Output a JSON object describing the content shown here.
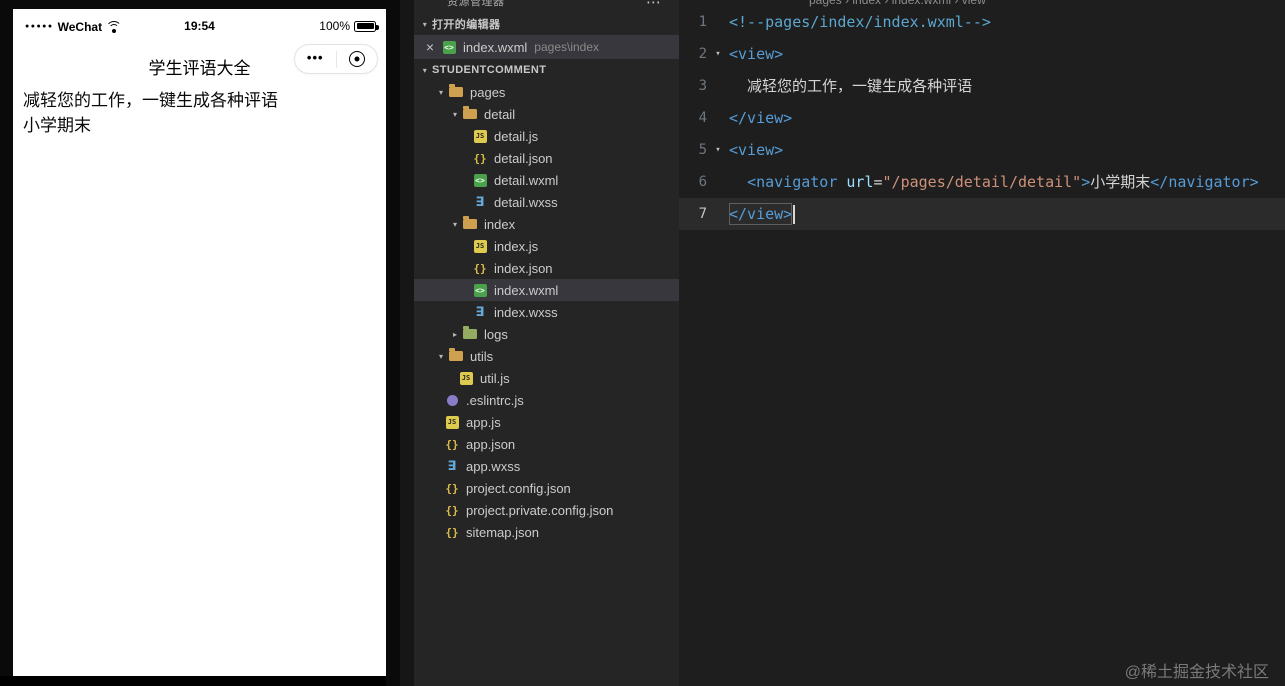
{
  "phone": {
    "status": {
      "signal_dots": "●●●●●",
      "carrier": "WeChat",
      "time": "19:54",
      "battery_pct": "100%"
    },
    "nav_title": "学生评语大全",
    "menu_label": "•••",
    "body_lines": [
      "减轻您的工作，一键生成各种评语",
      "小学期末"
    ]
  },
  "explorer": {
    "panel_title": "资源管理器",
    "open_editors_header": "打开的编辑器",
    "open_editor": {
      "file": "index.wxml",
      "path": "pages\\index",
      "icon": "wxml"
    },
    "project_header": "STUDENTCOMMENT",
    "tree": [
      {
        "label": "pages",
        "type": "folder",
        "depth": 1,
        "expanded": true
      },
      {
        "label": "detail",
        "type": "folder",
        "depth": 2,
        "expanded": true
      },
      {
        "label": "detail.js",
        "type": "js",
        "depth": 3
      },
      {
        "label": "detail.json",
        "type": "json",
        "depth": 3
      },
      {
        "label": "detail.wxml",
        "type": "wxml",
        "depth": 3
      },
      {
        "label": "detail.wxss",
        "type": "wxss",
        "depth": 3
      },
      {
        "label": "index",
        "type": "folder",
        "depth": 2,
        "expanded": true
      },
      {
        "label": "index.js",
        "type": "js",
        "depth": 3
      },
      {
        "label": "index.json",
        "type": "json",
        "depth": 3
      },
      {
        "label": "index.wxml",
        "type": "wxml",
        "depth": 3,
        "selected": true
      },
      {
        "label": "index.wxss",
        "type": "wxss",
        "depth": 3
      },
      {
        "label": "logs",
        "type": "folder",
        "depth": 2,
        "expanded": false,
        "color": "#94ad62"
      },
      {
        "label": "utils",
        "type": "folder",
        "depth": 1,
        "expanded": true
      },
      {
        "label": "util.js",
        "type": "js",
        "depth": 2
      },
      {
        "label": ".eslintrc.js",
        "type": "eslint",
        "depth": 1
      },
      {
        "label": "app.js",
        "type": "js",
        "depth": 1
      },
      {
        "label": "app.json",
        "type": "json",
        "depth": 1
      },
      {
        "label": "app.wxss",
        "type": "wxss",
        "depth": 1
      },
      {
        "label": "project.config.json",
        "type": "json",
        "depth": 1
      },
      {
        "label": "project.private.config.json",
        "type": "json",
        "depth": 1
      },
      {
        "label": "sitemap.json",
        "type": "json",
        "depth": 1
      }
    ]
  },
  "editor": {
    "breadcrumb": "pages › index › index.wxml › view",
    "colors": {
      "comment": "#5ba7cf",
      "tag": "#569cd6",
      "attr": "#9cdcfe",
      "string": "#ce9178",
      "text": "#d4d4d4",
      "punct": "#d4d4d4"
    },
    "lines": [
      {
        "num": "1",
        "tokens": [
          {
            "t": "<!--pages/index/index.wxml-->",
            "c": "comment"
          }
        ]
      },
      {
        "num": "2",
        "fold": true,
        "tokens": [
          {
            "t": "<view>",
            "c": "tag"
          }
        ]
      },
      {
        "num": "3",
        "tokens": [
          {
            "t": "  减轻您的工作，一键生成各种评语",
            "c": "text"
          }
        ]
      },
      {
        "num": "4",
        "tokens": [
          {
            "t": "</view>",
            "c": "tag"
          }
        ]
      },
      {
        "num": "5",
        "fold": true,
        "tokens": [
          {
            "t": "<view>",
            "c": "tag"
          }
        ]
      },
      {
        "num": "6",
        "tokens": [
          {
            "t": "  ",
            "c": "text"
          },
          {
            "t": "<navigator",
            "c": "tag"
          },
          {
            "t": " ",
            "c": "text"
          },
          {
            "t": "url",
            "c": "attr"
          },
          {
            "t": "=",
            "c": "punct"
          },
          {
            "t": "\"/pages/detail/detail\"",
            "c": "string"
          },
          {
            "t": ">",
            "c": "tag"
          },
          {
            "t": "小学期末",
            "c": "text"
          },
          {
            "t": "</navigator>",
            "c": "tag"
          }
        ]
      },
      {
        "num": "7",
        "current": true,
        "boxed": true,
        "tokens": [
          {
            "t": "</view>",
            "c": "tag"
          }
        ]
      }
    ]
  },
  "icons": {
    "close": "×",
    "more_horizontal": "⋯",
    "twisty_open": "▾",
    "twisty_closed": "▸",
    "js_glyph": "JS",
    "json_glyph": "{}",
    "wxml_glyph": "<>",
    "wxss_glyph": "∃",
    "folder_color": "#cfa050"
  },
  "watermark": "@稀土掘金技术社区"
}
